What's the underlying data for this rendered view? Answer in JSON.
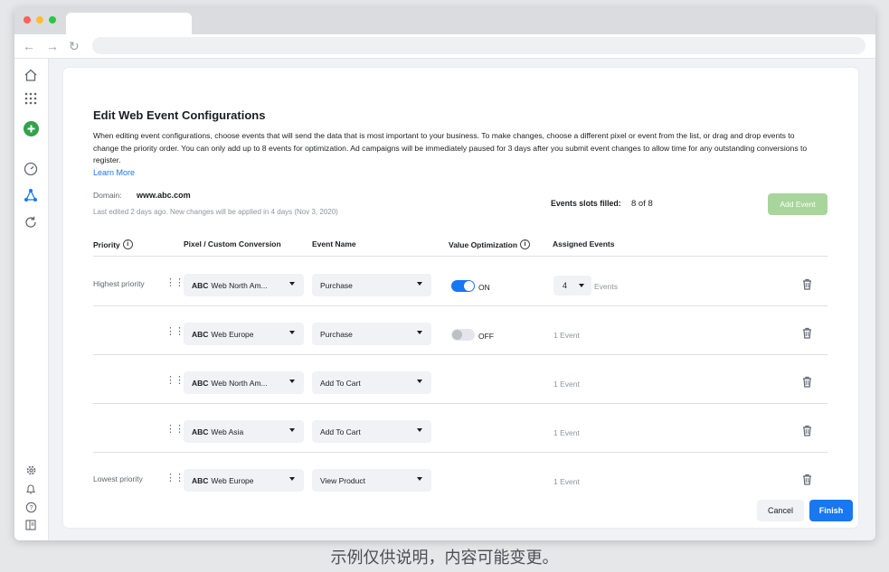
{
  "card": {
    "title": "Edit Web Event Configurations",
    "description": "When editing event configurations, choose events that will send the data that is most important to your business. To make changes, choose a different pixel or event from the list, or drag and drop events to change the priority order. You can only add up to 8 events for optimization. Ad campaigns will be immediately paused for 3 days after you submit event changes to allow time for any outstanding conversions to register.",
    "learn_more": "Learn More",
    "domain_label": "Domain:",
    "domain_value": "www.abc.com",
    "last_edited": "Last edited 2 days ago. New changes will be applied in 4 days (Nov 3, 2020)",
    "slots_label": "Events slots filled:",
    "slots_value": "8 of 8",
    "add_event": "Add Event"
  },
  "table": {
    "headers": {
      "priority": "Priority",
      "pixel": "Pixel / Custom Conversion",
      "event": "Event Name",
      "value_opt": "Value Optimization",
      "assigned": "Assigned Events"
    },
    "rows": [
      {
        "priority_label": "Highest priority",
        "brand": "ABC",
        "pixel": "Web North Am...",
        "event": "Purchase",
        "toggle": "ON",
        "assigned_value": "4",
        "assigned_suffix": "Events"
      },
      {
        "priority_label": "",
        "brand": "ABC",
        "pixel": "Web Europe",
        "event": "Purchase",
        "toggle": "OFF",
        "assigned_text": "1 Event"
      },
      {
        "priority_label": "",
        "brand": "ABC",
        "pixel": "Web North Am...",
        "event": "Add To Cart",
        "assigned_text": "1 Event"
      },
      {
        "priority_label": "",
        "brand": "ABC",
        "pixel": "Web Asia",
        "event": "Add To Cart",
        "assigned_text": "1 Event"
      },
      {
        "priority_label": "Lowest priority",
        "brand": "ABC",
        "pixel": "Web Europe",
        "event": "View Product",
        "assigned_text": "1 Event"
      }
    ]
  },
  "footer": {
    "cancel": "Cancel",
    "finish": "Finish"
  },
  "caption": "示例仅供说明，内容可能变更。",
  "colors": {
    "primary": "#1877f2",
    "add_event_disabled": "#a8d59b",
    "create_green": "#31a24c"
  },
  "icons": {
    "sidebar_top": [
      "home-icon",
      "apps-grid-icon",
      "create-plus-icon",
      "dashboard-gauge-icon",
      "events-manager-icon",
      "refresh-icon"
    ],
    "sidebar_bottom": [
      "settings-icon",
      "notifications-bell-icon",
      "help-icon",
      "panel-toggle-icon"
    ]
  }
}
